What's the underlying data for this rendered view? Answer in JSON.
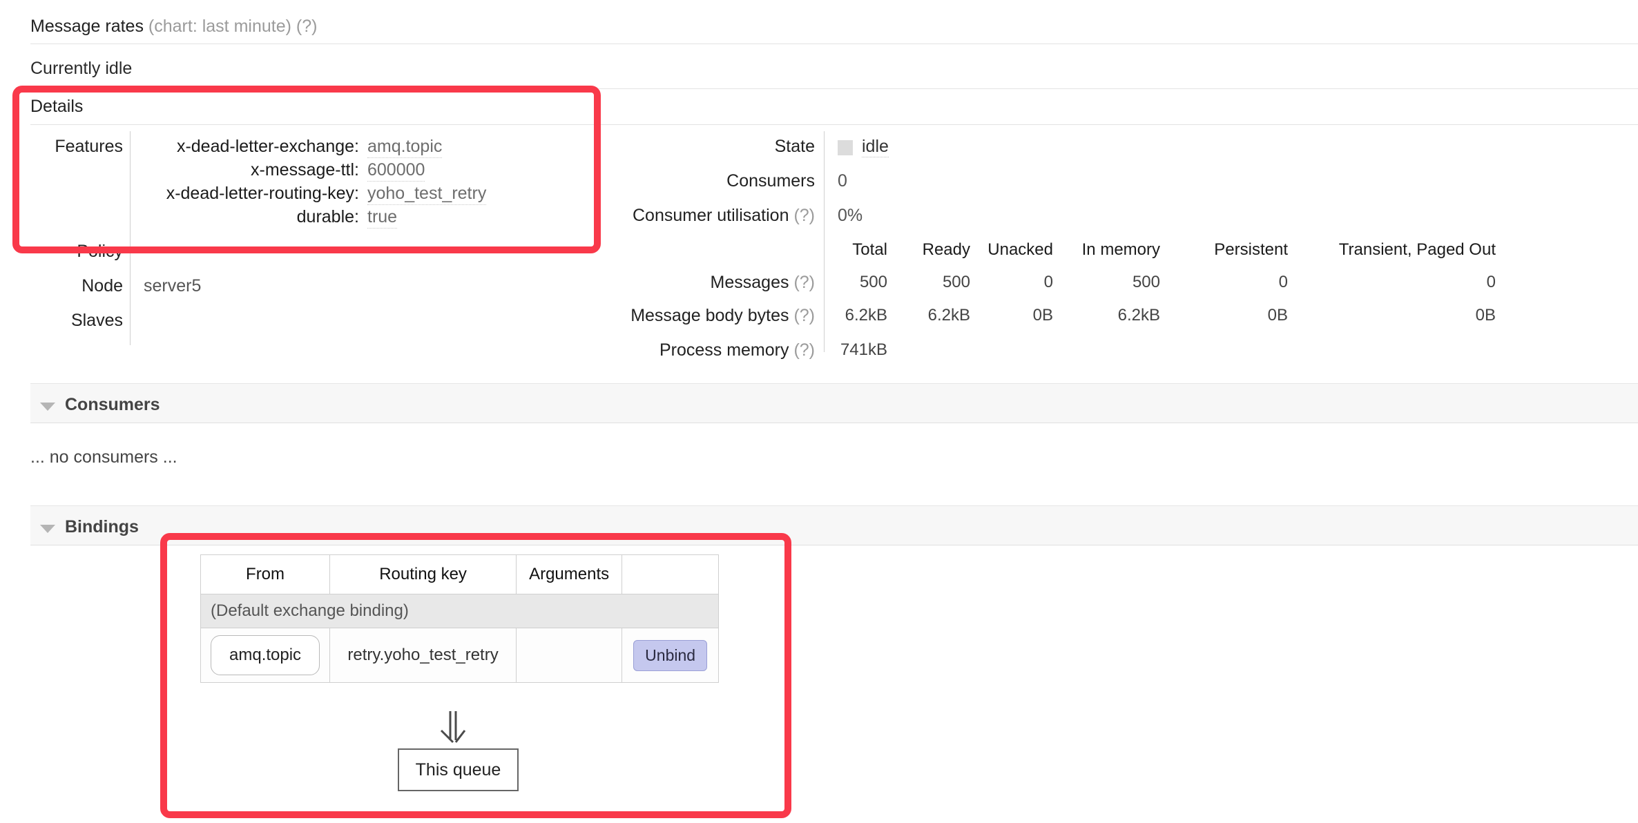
{
  "message_rates": {
    "title": "Message rates",
    "chart_note": "(chart: last minute)",
    "help": "(?)",
    "status": "Currently idle"
  },
  "details": {
    "title": "Details",
    "features_label": "Features",
    "features": [
      {
        "key": "x-dead-letter-exchange:",
        "value": "amq.topic"
      },
      {
        "key": "x-message-ttl:",
        "value": "600000"
      },
      {
        "key": "x-dead-letter-routing-key:",
        "value": "yoho_test_retry"
      },
      {
        "key": "durable:",
        "value": "true"
      }
    ],
    "policy_label": "Policy",
    "policy_value": "",
    "node_label": "Node",
    "node_value": "server5",
    "slaves_label": "Slaves",
    "slaves_value": ""
  },
  "stats": {
    "state_label": "State",
    "state_value": "idle",
    "consumers_label": "Consumers",
    "consumers_value": "0",
    "consumer_utilisation_label": "Consumer utilisation",
    "consumer_utilisation_help": "(?)",
    "consumer_utilisation_value": "0%",
    "columns": [
      "Total",
      "Ready",
      "Unacked",
      "In memory",
      "Persistent",
      "Transient, Paged Out"
    ],
    "rows": [
      {
        "label": "Messages",
        "help": "(?)",
        "values": [
          "500",
          "500",
          "0",
          "500",
          "0",
          "0"
        ]
      },
      {
        "label": "Message body bytes",
        "help": "(?)",
        "values": [
          "6.2kB",
          "6.2kB",
          "0B",
          "6.2kB",
          "0B",
          "0B"
        ]
      },
      {
        "label": "Process memory",
        "help": "(?)",
        "values": [
          "741kB",
          "",
          "",
          "",
          "",
          ""
        ]
      }
    ]
  },
  "consumers_section": {
    "title": "Consumers",
    "empty_text": "... no consumers ..."
  },
  "bindings_section": {
    "title": "Bindings",
    "columns": [
      "From",
      "Routing key",
      "Arguments",
      ""
    ],
    "default_binding_text": "(Default exchange binding)",
    "rows": [
      {
        "from": "amq.topic",
        "routing_key": "retry.yoho_test_retry",
        "arguments": "",
        "action": "Unbind"
      }
    ],
    "this_queue_label": "This queue"
  },
  "annotation": {
    "highlight_color": "#f9394a"
  }
}
